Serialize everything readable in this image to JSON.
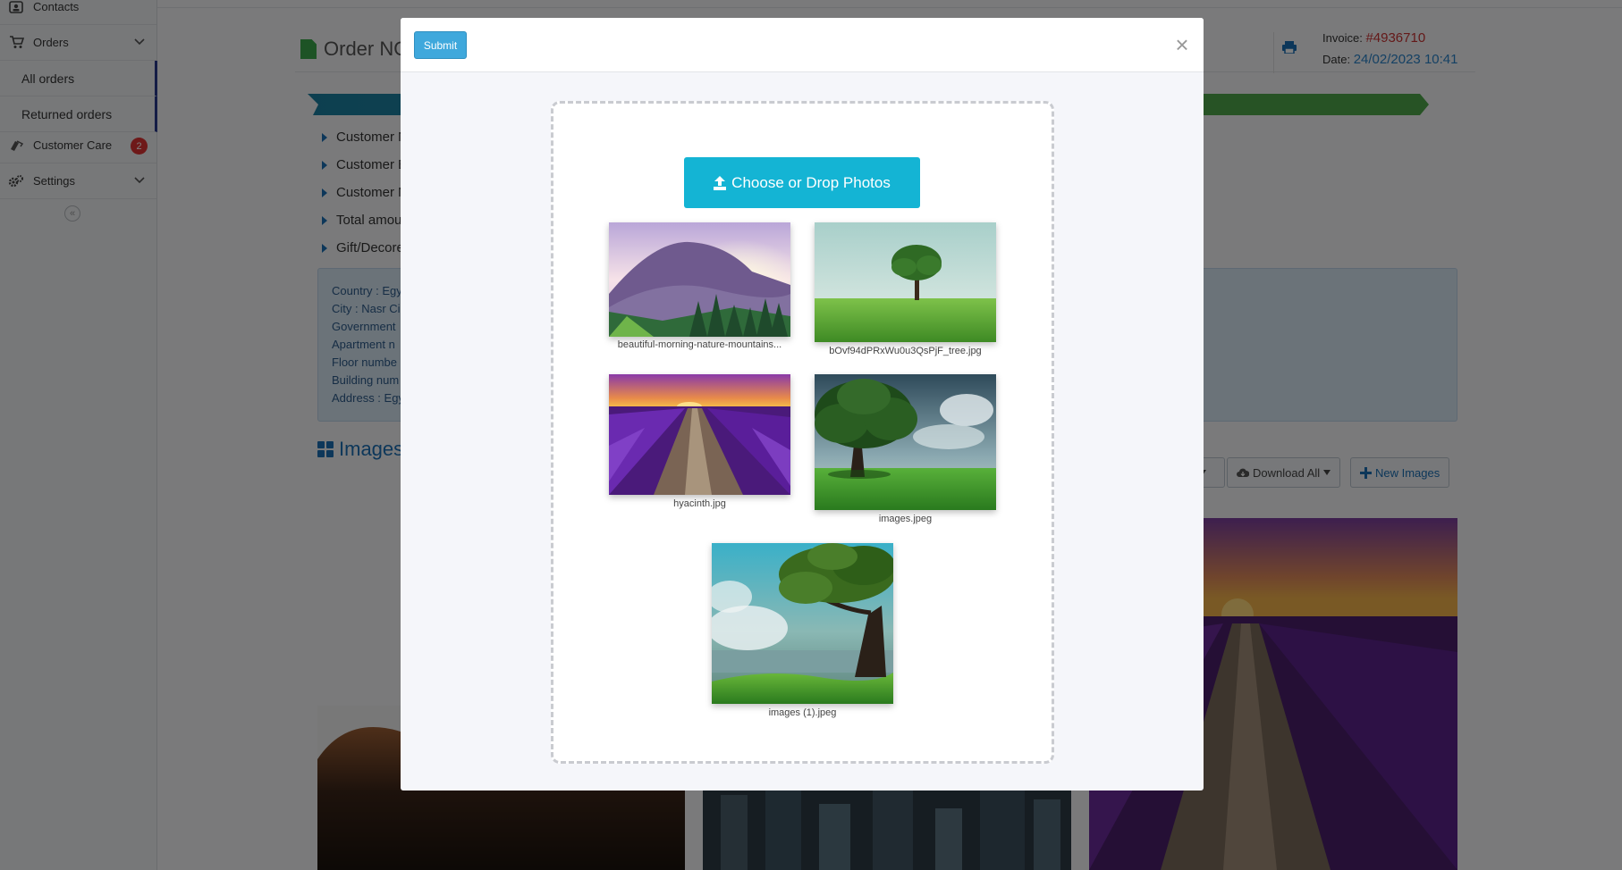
{
  "sidebar": {
    "items": [
      {
        "label": "Contacts",
        "icon": "contacts-icon"
      },
      {
        "label": "Orders",
        "icon": "cart-icon"
      },
      {
        "label": "Customer Care",
        "icon": "care-icon",
        "badge": "2"
      },
      {
        "label": "Settings",
        "icon": "gears-icon"
      }
    ],
    "orders_sub": [
      "All orders",
      "Returned orders"
    ],
    "collapse_glyph": "«"
  },
  "page": {
    "title": "Order NO",
    "invoice_label": "Invoice:",
    "invoice_value": "#4936710",
    "date_label": "Date:",
    "date_value": "24/02/2023 10:41",
    "info_items": [
      "Customer N",
      "Customer E",
      "Customer M",
      "Total amou",
      "Gift/Decore"
    ],
    "address_lines": [
      "Country : Egy",
      "City : Nasr Ci",
      "Government",
      "Apartment n",
      "Floor numbe",
      "Building num",
      "Address : Egy"
    ],
    "images_heading": "Images",
    "download_all": "Download All",
    "new_images": "New Images",
    "colors": {
      "accent": "#1b6fb5",
      "progress_start": "#1a7fa0",
      "progress_end": "#4fa64a",
      "invoice": "#c83232"
    }
  },
  "modal": {
    "submit_label": "Submit",
    "close_glyph": "×",
    "choose_label": "Choose or Drop Photos",
    "photos": [
      {
        "caption": "beautiful-morning-nature-mountains...",
        "scene": "mountain-sunrise"
      },
      {
        "caption": "bOvf94dPRxWu0u3QsPjF_tree.jpg",
        "scene": "tree-field"
      },
      {
        "caption": "hyacinth.jpg",
        "scene": "flower-field"
      },
      {
        "caption": "images.jpeg",
        "scene": "big-tree"
      },
      {
        "caption": "images (1).jpeg",
        "scene": "tree-cliff"
      }
    ]
  }
}
